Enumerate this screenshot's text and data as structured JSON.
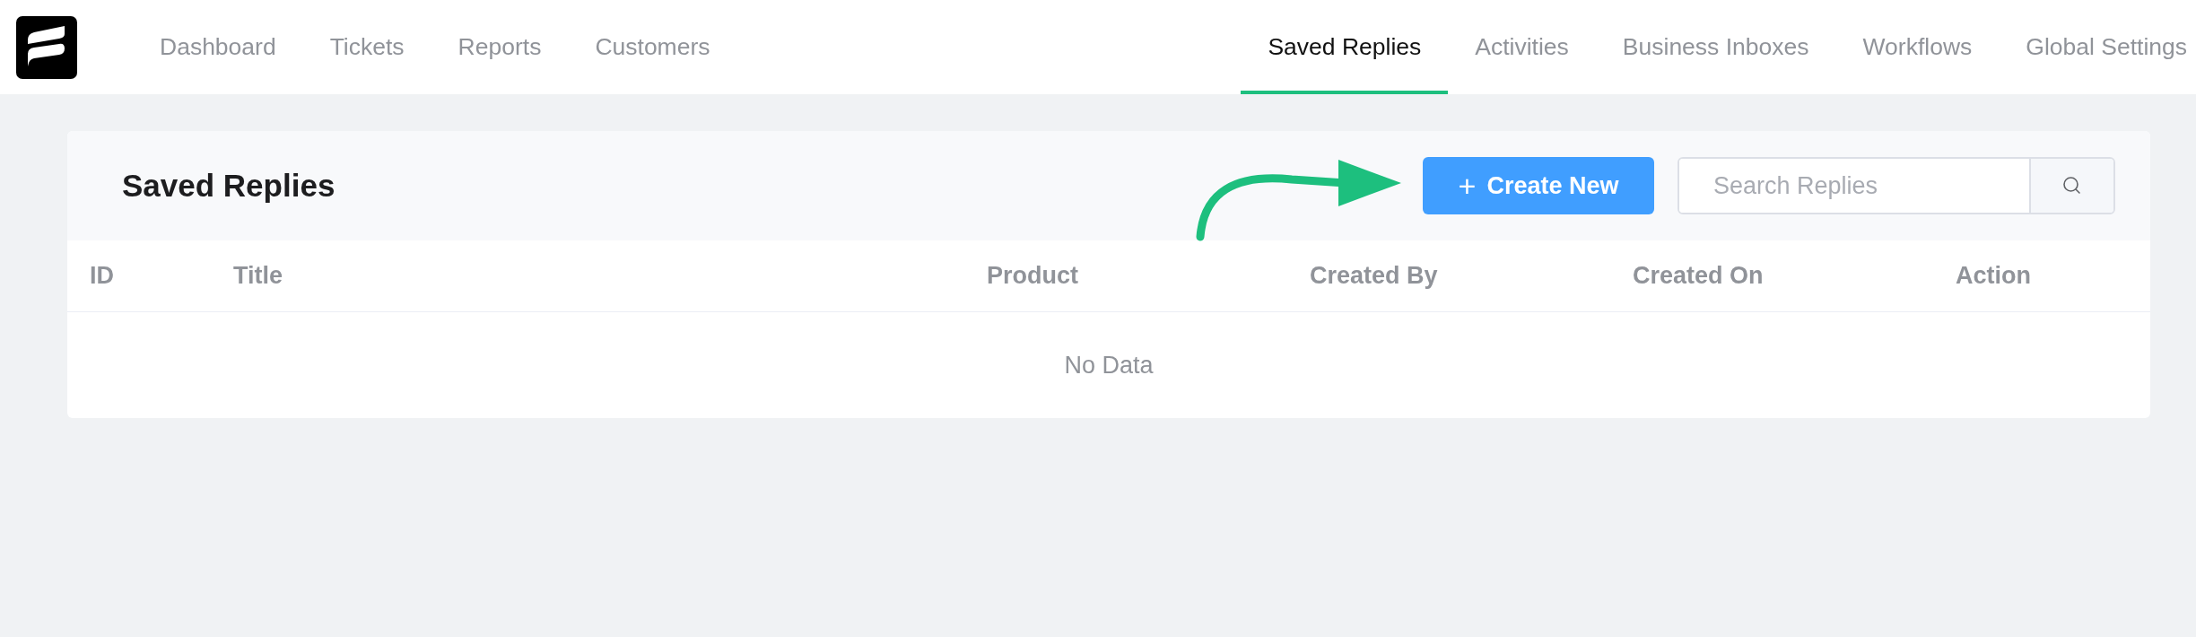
{
  "nav": {
    "left": [
      {
        "label": "Dashboard",
        "selected": false
      },
      {
        "label": "Tickets",
        "selected": false
      },
      {
        "label": "Reports",
        "selected": false
      },
      {
        "label": "Customers",
        "selected": false
      }
    ],
    "right": [
      {
        "label": "Saved Replies",
        "selected": true
      },
      {
        "label": "Activities",
        "selected": false
      },
      {
        "label": "Business Inboxes",
        "selected": false
      },
      {
        "label": "Workflows",
        "selected": false
      },
      {
        "label": "Global Settings",
        "selected": false
      }
    ]
  },
  "panel": {
    "title": "Saved Replies",
    "create_button": {
      "icon": "+",
      "label": "Create New"
    },
    "search": {
      "placeholder": "Search Replies"
    }
  },
  "table": {
    "columns": [
      "ID",
      "Title",
      "Product",
      "Created By",
      "Created On",
      "Action"
    ],
    "empty_text": "No Data"
  }
}
